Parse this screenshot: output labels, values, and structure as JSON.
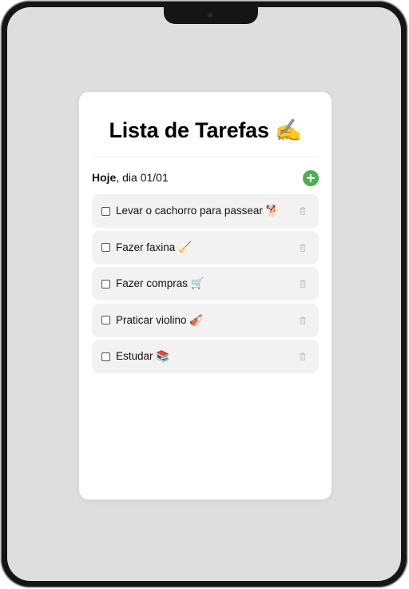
{
  "app": {
    "title": "Lista de Tarefas ✍️",
    "date_prefix": "Hoje",
    "date_suffix": ", dia 01/01"
  },
  "tasks": [
    {
      "label": "Levar o cachorro para passear 🐕",
      "checked": false
    },
    {
      "label": "Fazer faxina 🧹",
      "checked": false
    },
    {
      "label": "Fazer compras 🛒",
      "checked": false
    },
    {
      "label": "Praticar violino 🎻",
      "checked": false
    },
    {
      "label": "Estudar 📚",
      "checked": false
    }
  ],
  "icons": {
    "add": "plus-circle-icon",
    "delete": "trash-icon",
    "camera": "camera-icon"
  },
  "colors": {
    "accent": "#4caf50",
    "screen_bg": "#dedede",
    "card_bg": "#ffffff",
    "task_bg": "#f2f2f2",
    "trash": "#c8c8c8"
  }
}
